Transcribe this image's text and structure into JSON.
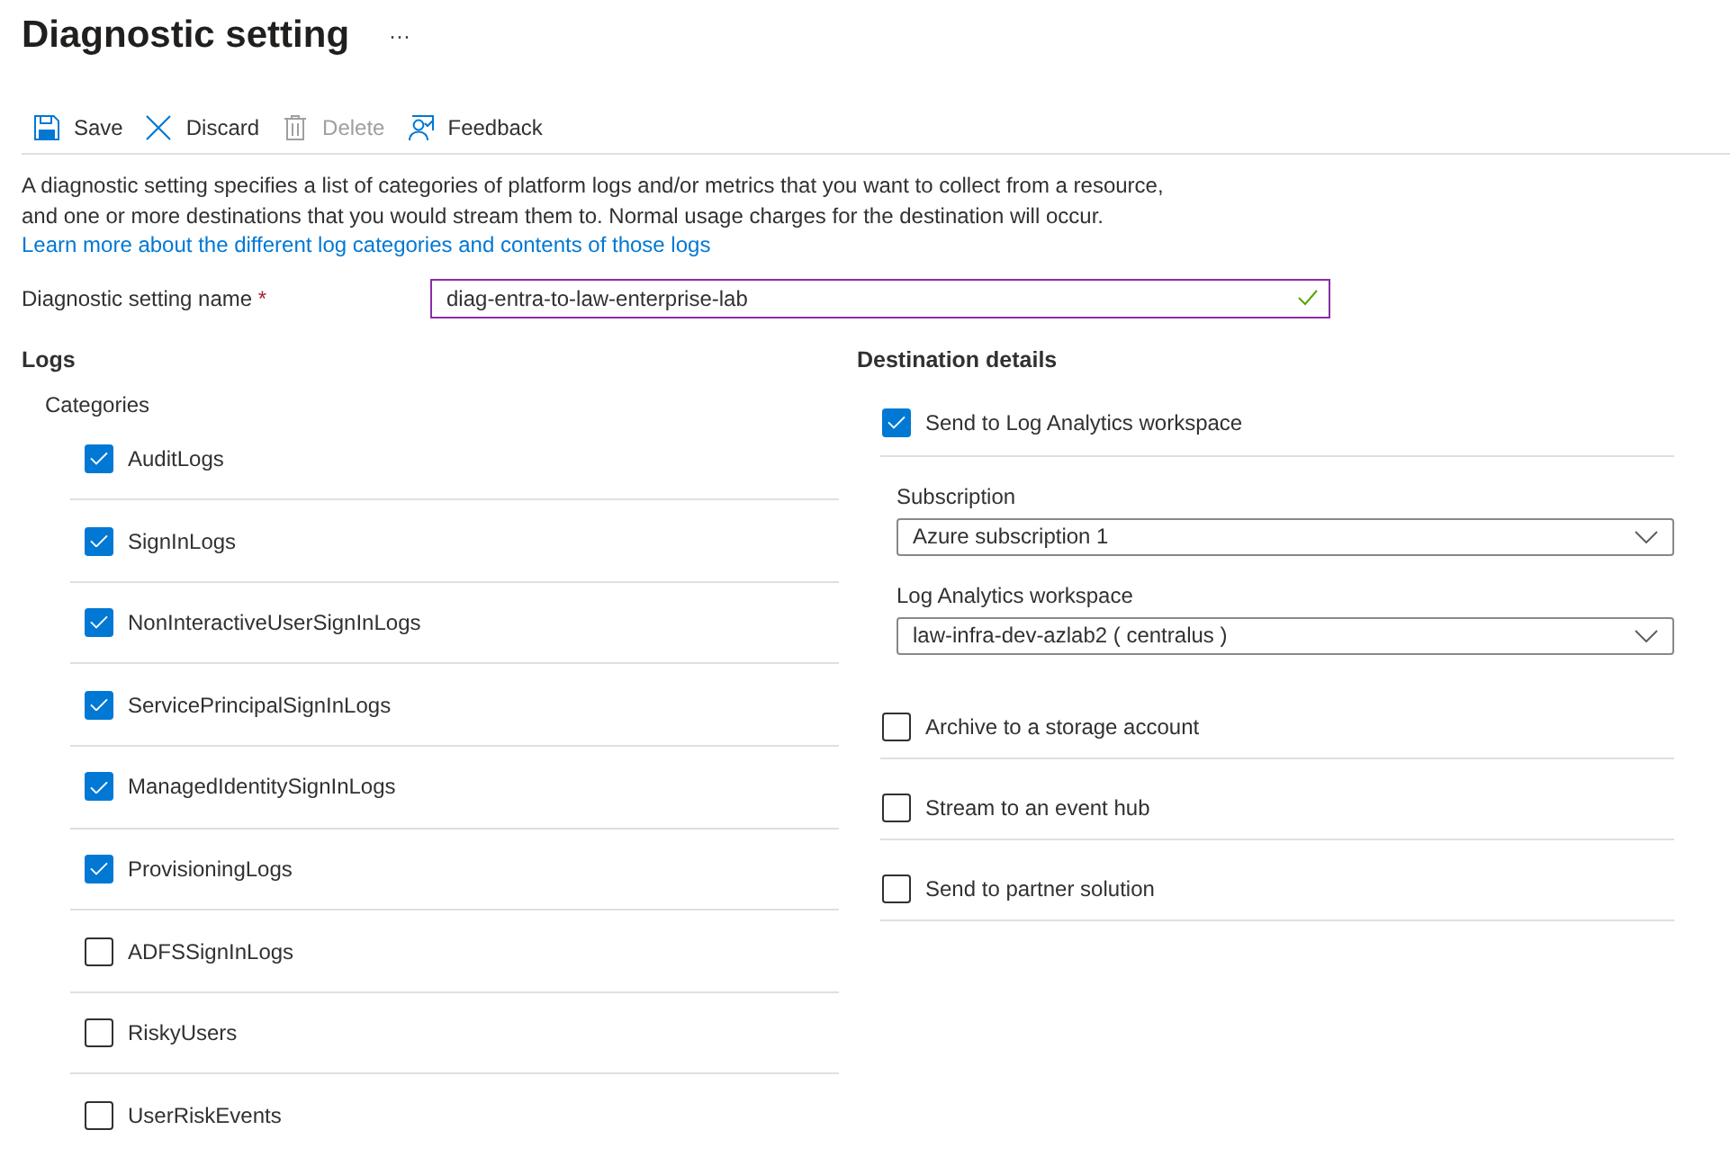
{
  "header": {
    "title": "Diagnostic setting",
    "more_button": "···"
  },
  "toolbar": [
    {
      "kind": "save",
      "label": "Save",
      "disabled": false
    },
    {
      "kind": "discard",
      "label": "Discard",
      "disabled": false
    },
    {
      "kind": "delete",
      "label": "Delete",
      "disabled": true
    },
    {
      "kind": "feedback",
      "label": "Feedback",
      "disabled": false
    }
  ],
  "description": {
    "text": "A diagnostic setting specifies a list of categories of platform logs and/or metrics that you want to collect from a resource, and one or more destinations that you would stream them to. Normal usage charges for the destination will occur.",
    "link": "Learn more about the different log categories and contents of those logs"
  },
  "name_field": {
    "label": "Diagnostic setting name",
    "required_mark": "*",
    "value": "diag-entra-to-law-enterprise-lab",
    "valid": true
  },
  "logs": {
    "title": "Logs",
    "categories_label": "Categories",
    "categories": [
      {
        "label": "AuditLogs",
        "checked": true
      },
      {
        "label": "SignInLogs",
        "checked": true
      },
      {
        "label": "NonInteractiveUserSignInLogs",
        "checked": true
      },
      {
        "label": "ServicePrincipalSignInLogs",
        "checked": true
      },
      {
        "label": "ManagedIdentitySignInLogs",
        "checked": true
      },
      {
        "label": "ProvisioningLogs",
        "checked": true
      },
      {
        "label": "ADFSSignInLogs",
        "checked": false
      },
      {
        "label": "RiskyUsers",
        "checked": false
      },
      {
        "label": "UserRiskEvents",
        "checked": false
      }
    ]
  },
  "destination": {
    "title": "Destination details",
    "log_analytics": {
      "label": "Send to Log Analytics workspace",
      "checked": true
    },
    "subscription": {
      "label": "Subscription",
      "value": "Azure subscription 1"
    },
    "workspace": {
      "label": "Log Analytics workspace",
      "value": "law-infra-dev-azlab2 ( centralus )"
    },
    "options": [
      {
        "label": "Archive to a storage account",
        "checked": false
      },
      {
        "label": "Stream to an event hub",
        "checked": false
      },
      {
        "label": "Send to partner solution",
        "checked": false
      }
    ]
  }
}
